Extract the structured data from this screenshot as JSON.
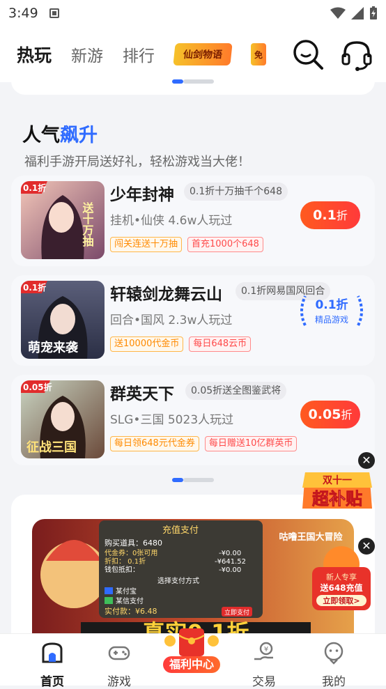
{
  "status": {
    "time": "3:49"
  },
  "tabs": [
    {
      "label": "热玩"
    },
    {
      "label": "新游"
    },
    {
      "label": "排行"
    }
  ],
  "tab_logo_1": "仙剑物语",
  "tab_logo_2": "免",
  "section": {
    "title_a": "人气",
    "title_b": "飙升",
    "subtitle": "福利手游开局送好礼，轻松游戏当大佬！"
  },
  "games": [
    {
      "name": "少年封神",
      "promo": "0.1折十万抽千个648",
      "meta": "挂机•仙侠  4.6w人玩过",
      "tags": [
        "闯关连送十万抽",
        "首充1000个648"
      ],
      "discount": "0.1",
      "discount_unit": "折",
      "cover_badge": "0.1折",
      "cover_text": "送十万抽"
    },
    {
      "name": "轩辕剑龙舞云山",
      "promo": "0.1折网易国风回合",
      "meta": "回合•国风  2.3w人玩过",
      "tags": [
        "送10000代金币",
        "每日648云币"
      ],
      "badge_value": "0.1折",
      "badge_label": "精品游戏",
      "cover_badge": "0.1折",
      "cover_text": "萌宠来袭"
    },
    {
      "name": "群英天下",
      "promo": "0.05折送全图鉴武将",
      "meta": "SLG•三国  5023人玩过",
      "tags": [
        "每日领648元代金券",
        "每日赠送10亿群英币"
      ],
      "discount": "0.05",
      "discount_unit": "折",
      "cover_badge": "0.05折",
      "cover_text": "征战三国"
    }
  ],
  "banner": {
    "pay_title": "充值支付",
    "item": "购买道具：6480",
    "rows": [
      "代金券：0张可用",
      "折扣：  0.1折",
      "钱包抵扣："
    ],
    "amounts": [
      "-¥0.00",
      "-¥641.52",
      "-¥0.00"
    ],
    "method_title": "选择支付方式",
    "methods": [
      "某付宝",
      "某信支付"
    ],
    "pay_amount": "实付款：¥6.48",
    "pay_button": "立即支付",
    "headline": "真实0.1折",
    "right_title": "咕噜王国大冒险"
  },
  "float_ad": {
    "line1": "双十一",
    "line2": "超补贴",
    "close": "✕"
  },
  "float_ad2": {
    "line1": "新人专享",
    "line2": "送648充值",
    "line3": "立即领取>",
    "close": "✕"
  },
  "bottom_nav": [
    {
      "label": "首页"
    },
    {
      "label": "游戏"
    },
    {
      "label": "福利中心"
    },
    {
      "label": "交易"
    },
    {
      "label": "我的"
    }
  ],
  "colors": {
    "accent": "#2f6bff",
    "discount": "#ff3a3a",
    "tag_orange": "#ff8a00",
    "tag_red": "#ff4a4a"
  }
}
